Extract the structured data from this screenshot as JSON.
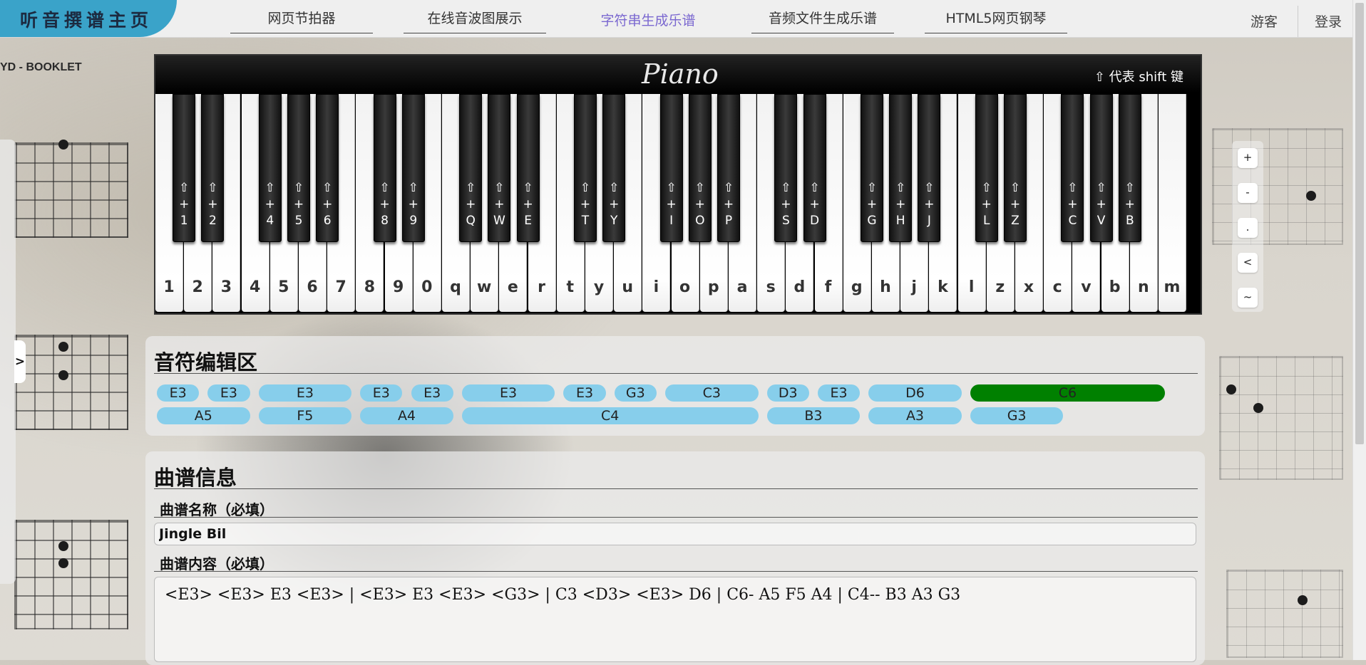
{
  "nav": {
    "logo": "听音撰谱主页",
    "links": [
      "网页节拍器",
      "在线音波图展示",
      "字符串生成乐谱",
      "音频文件生成乐谱",
      "HTML5网页钢琴"
    ],
    "guest": "游客",
    "login": "登录"
  },
  "background": {
    "booklet_text": "YD - BOOKLET"
  },
  "piano": {
    "logo": "Piano",
    "shift_note": "⇧ 代表 shift 键",
    "white_keys": [
      "1",
      "2",
      "3",
      "4",
      "5",
      "6",
      "7",
      "8",
      "9",
      "0",
      "q",
      "w",
      "e",
      "r",
      "t",
      "y",
      "u",
      "i",
      "o",
      "p",
      "a",
      "s",
      "d",
      "f",
      "g",
      "h",
      "j",
      "k",
      "l",
      "z",
      "x",
      "c",
      "v",
      "b",
      "n",
      "m"
    ],
    "black_keys": [
      {
        "after": 0,
        "key": "1"
      },
      {
        "after": 1,
        "key": "2"
      },
      {
        "after": 3,
        "key": "4"
      },
      {
        "after": 4,
        "key": "5"
      },
      {
        "after": 5,
        "key": "6"
      },
      {
        "after": 7,
        "key": "8"
      },
      {
        "after": 8,
        "key": "9"
      },
      {
        "after": 10,
        "key": "Q"
      },
      {
        "after": 11,
        "key": "W"
      },
      {
        "after": 12,
        "key": "E"
      },
      {
        "after": 14,
        "key": "T"
      },
      {
        "after": 15,
        "key": "Y"
      },
      {
        "after": 17,
        "key": "I"
      },
      {
        "after": 18,
        "key": "O"
      },
      {
        "after": 19,
        "key": "P"
      },
      {
        "after": 21,
        "key": "S"
      },
      {
        "after": 22,
        "key": "D"
      },
      {
        "after": 24,
        "key": "G"
      },
      {
        "after": 25,
        "key": "H"
      },
      {
        "after": 26,
        "key": "J"
      },
      {
        "after": 28,
        "key": "L"
      },
      {
        "after": 29,
        "key": "Z"
      },
      {
        "after": 31,
        "key": "C"
      },
      {
        "after": 32,
        "key": "V"
      },
      {
        "after": 33,
        "key": "B"
      }
    ],
    "shift_symbol": "⇧",
    "plus_symbol": "+"
  },
  "controls": [
    "+",
    "-",
    ".",
    "<",
    "~"
  ],
  "note_editor": {
    "title": "音符编辑区",
    "row1": [
      {
        "label": "E3",
        "span": 1
      },
      {
        "label": "E3",
        "span": 1
      },
      {
        "label": "E3",
        "span": 2
      },
      {
        "label": "E3",
        "span": 1
      },
      {
        "label": "E3",
        "span": 1
      },
      {
        "label": "E3",
        "span": 2
      },
      {
        "label": "E3",
        "span": 1
      },
      {
        "label": "G3",
        "span": 1
      },
      {
        "label": "C3",
        "span": 2
      },
      {
        "label": "D3",
        "span": 1
      },
      {
        "label": "E3",
        "span": 1
      },
      {
        "label": "D6",
        "span": 2
      },
      {
        "label": "C6",
        "span": 4,
        "active": true
      }
    ],
    "row2": [
      {
        "label": "A5",
        "span": 2
      },
      {
        "label": "F5",
        "span": 2
      },
      {
        "label": "A4",
        "span": 2
      },
      {
        "label": "C4",
        "span": 6
      },
      {
        "label": "B3",
        "span": 2
      },
      {
        "label": "A3",
        "span": 2
      },
      {
        "label": "G3",
        "span": 2
      }
    ]
  },
  "score_info": {
    "title": "曲谱信息",
    "name_label": "曲谱名称（必填）",
    "name_value": "Jingle Bil",
    "content_label": "曲谱内容（必填）",
    "content_value": "<E3> <E3> E3 <E3> | <E3> E3 <E3> <G3> | C3 <D3> <E3> D6 | C6- A5 F5 A4 | C4-- B3 A3 G3"
  }
}
